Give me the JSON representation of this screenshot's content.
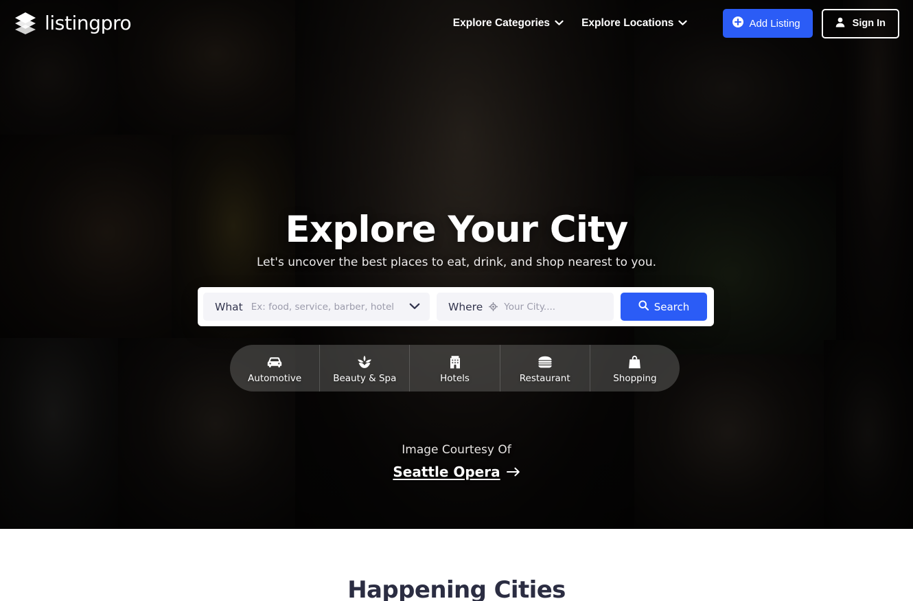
{
  "brand": {
    "name": "listingpro",
    "logo_icon": "layers-stack-icon"
  },
  "header": {
    "nav": [
      {
        "label": "Explore Categories",
        "icon": "chevron-down-icon"
      },
      {
        "label": "Explore Locations",
        "icon": "chevron-down-icon"
      }
    ],
    "add_listing": {
      "label": "Add Listing",
      "icon": "plus-circle-icon"
    },
    "sign_in": {
      "label": "Sign In",
      "icon": "user-icon"
    },
    "accent_color": "#2b5cf6"
  },
  "hero": {
    "title": "Explore Your City",
    "subtitle": "Let's uncover the best places to eat, drink, and shop nearest to you."
  },
  "search": {
    "what_label": "What",
    "what_placeholder": "Ex: food, service, barber, hotel",
    "what_value": "",
    "what_icon": "chevron-down-icon",
    "where_label": "Where",
    "where_icon": "location-crosshair-icon",
    "where_placeholder": "Your City....",
    "where_value": "",
    "search_button": "Search",
    "search_icon": "search-icon"
  },
  "categories": [
    {
      "label": "Automotive",
      "icon": "car-icon"
    },
    {
      "label": "Beauty & Spa",
      "icon": "lotus-icon"
    },
    {
      "label": "Hotels",
      "icon": "hotel-building-icon"
    },
    {
      "label": "Restaurant",
      "icon": "burger-icon"
    },
    {
      "label": "Shopping",
      "icon": "shopping-bag-icon"
    }
  ],
  "credit": {
    "prefix": "Image Courtesy Of",
    "link": "Seattle Opera",
    "arrow_icon": "arrow-right-icon"
  },
  "section": {
    "title": "Happening Cities"
  }
}
